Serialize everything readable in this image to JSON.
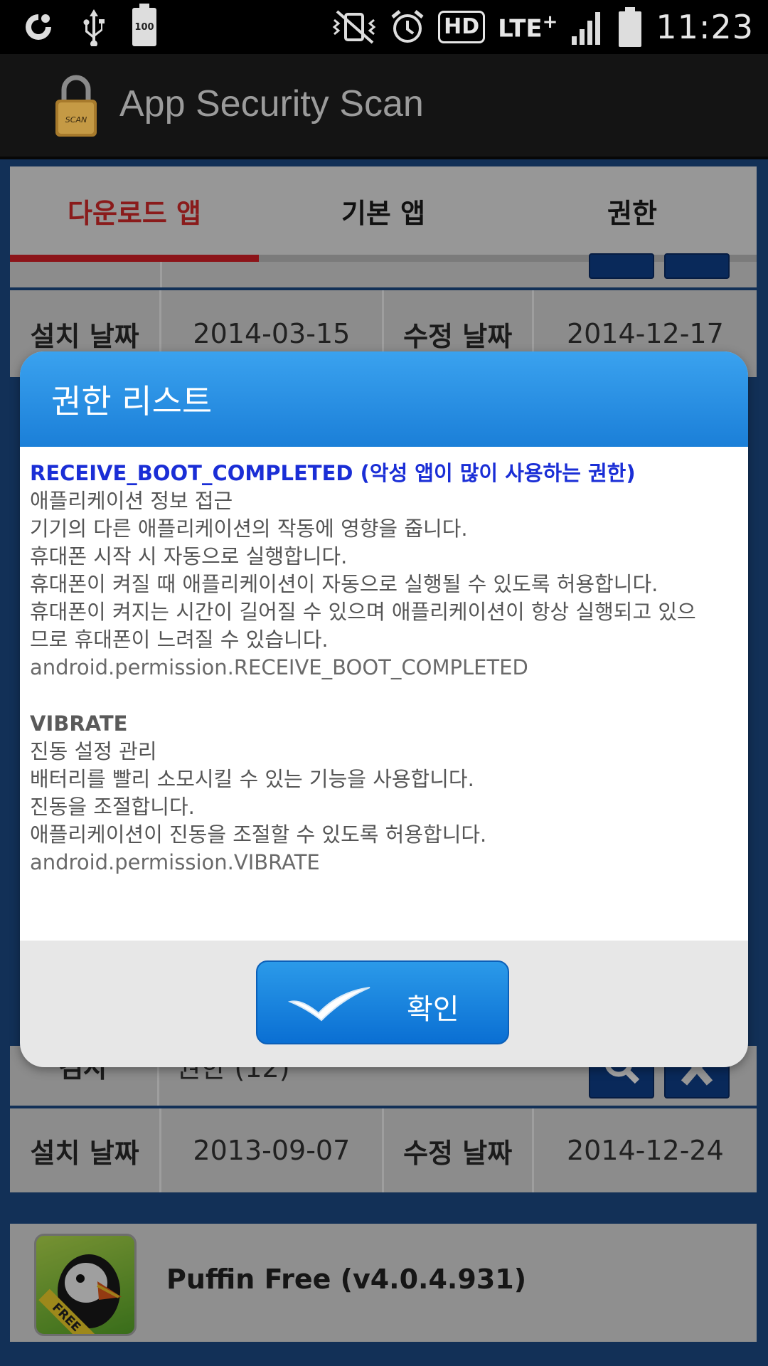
{
  "status_bar": {
    "battery_level": "100",
    "network_badge": "HD",
    "network_type": "LTE",
    "time": "11:23"
  },
  "action_bar": {
    "logo_text": "SCAN",
    "title": "App Security Scan"
  },
  "tabs": [
    {
      "label": "다운로드 앱",
      "active": true
    },
    {
      "label": "기본 앱",
      "active": false
    },
    {
      "label": "권한",
      "active": false
    }
  ],
  "background_rows": {
    "row1": {
      "install_label": "설치 날짜",
      "install_date": "2014-03-15",
      "modified_label": "수정 날짜",
      "modified_date": "2014-12-17"
    },
    "row2": {
      "install_label": "설치 날짜",
      "install_date": "2013-09-07",
      "modified_label": "수정 날짜",
      "modified_date": "2014-12-24"
    },
    "partial_row": {
      "label": "검사",
      "value": "권한 (12)"
    }
  },
  "app_card": {
    "name": "Puffin Free (v4.0.4.931)",
    "icon_badge": "FREE"
  },
  "dialog": {
    "title": "권한 리스트",
    "permissions": [
      {
        "name": "RECEIVE_BOOT_COMPLETED (악성 앱이 많이 사용하는 권한)",
        "lines": [
          "애플리케이션 정보 접근",
          "기기의 다른 애플리케이션의 작동에 영향을 줍니다.",
          "휴대폰 시작 시 자동으로 실행합니다.",
          "휴대폰이 켜질 때 애플리케이션이 자동으로 실행될 수 있도록 허용합니다.",
          "휴대폰이 켜지는 시간이 길어질 수 있으며 애플리케이션이 항상 실행되고 있으므로 휴대폰이 느려질 수 있습니다."
        ],
        "id": "android.permission.RECEIVE_BOOT_COMPLETED"
      },
      {
        "name": "VIBRATE",
        "lines": [
          "진동 설정 관리",
          "배터리를 빨리 소모시킬 수 있는 기능을 사용합니다.",
          "진동을 조절합니다.",
          "애플리케이션이 진동을 조절할 수 있도록 허용합니다."
        ],
        "id": "android.permission.VIBRATE"
      }
    ],
    "confirm_label": "확인"
  },
  "colors": {
    "accent_red": "#d81f27",
    "dialog_header": "#2a90e4",
    "highlight_permission": "#1a2ed6"
  }
}
